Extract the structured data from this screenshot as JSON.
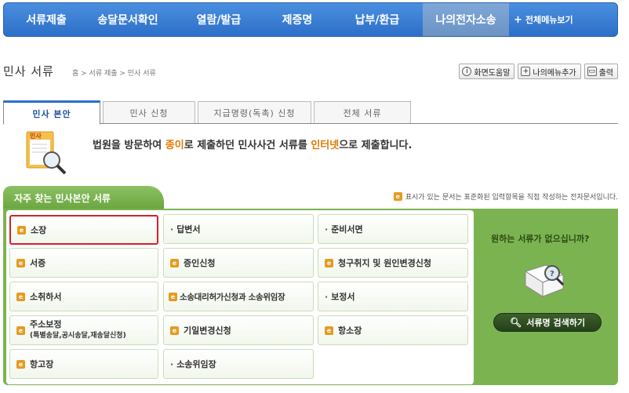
{
  "nav": {
    "items": [
      "서류제출",
      "송달문서확인",
      "열람/발급",
      "제증명",
      "납부/환급",
      "나의전자소송"
    ],
    "all_menu": "전체메뉴보기"
  },
  "page": {
    "title": "민사 서류",
    "breadcrumb": "홈 > 서류 제출 > 민사 서류"
  },
  "tools": [
    "화면도움말",
    "나의메뉴추가",
    "출력"
  ],
  "tabs": [
    "민사 본안",
    "민사 신청",
    "지급명령(독촉) 신청",
    "전체 서류"
  ],
  "intro": {
    "icon_label": "민사",
    "text_a": "법원을 방문하여 ",
    "text_b": "종이",
    "text_c": "로 제출하던 민사사건 서류를 ",
    "text_d": "인터넷",
    "text_e": "으로 제출합니다."
  },
  "section": {
    "title": "자주 찾는 민사본안 서류",
    "legend": "표시가 있는 문서는 표준화된 입력항목을 직접 작성하는 전자문서입니다."
  },
  "documents": {
    "r1c1": "소장",
    "r1c2": "답변서",
    "r1c3": "준비서면",
    "r2c1": "서증",
    "r2c2": "증인신청",
    "r2c3": "청구취지 및 원인변경신청",
    "r3c1": "소취하서",
    "r3c2": "소송대리허가신청과 소송위임장",
    "r3c3": "보정서",
    "r4c1": "주소보정",
    "r4c1_sub": "(특별송달,공시송달,재송달신청)",
    "r4c2": "기일변경신청",
    "r4c3": "항소장",
    "r5c1": "항고장",
    "r5c2": "소송위임장"
  },
  "side": {
    "question": "원하는 서류가 없으십니까?",
    "search_button": "서류명 검색하기"
  },
  "colors": {
    "nav_blue": "#2c6fc7",
    "panel_green": "#7cb351",
    "highlight_orange": "#e07a00",
    "selected_red": "#d6202a"
  }
}
